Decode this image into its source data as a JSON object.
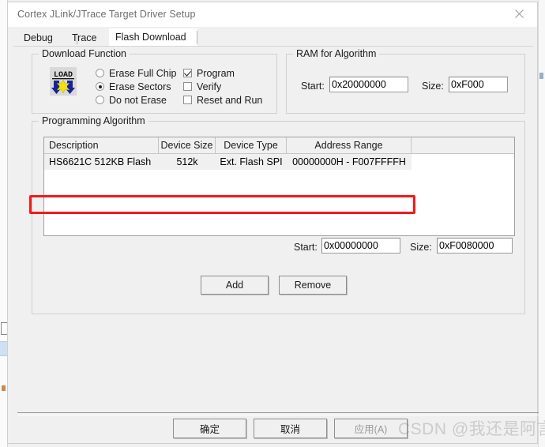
{
  "window": {
    "title": "Cortex JLink/JTrace Target Driver Setup",
    "close_icon": "close-icon"
  },
  "tabs": [
    {
      "label": "Debug",
      "active": false
    },
    {
      "label": "Trace",
      "active": false
    },
    {
      "label": "Flash Download",
      "active": true
    }
  ],
  "download_function": {
    "title": "Download Function",
    "icon": "load-icon",
    "radios": [
      {
        "label": "Erase Full Chip",
        "selected": false
      },
      {
        "label": "Erase Sectors",
        "selected": true
      },
      {
        "label": "Do not Erase",
        "selected": false
      }
    ],
    "checkboxes": [
      {
        "label": "Program",
        "checked": true
      },
      {
        "label": "Verify",
        "checked": false
      },
      {
        "label": "Reset and Run",
        "checked": false
      }
    ]
  },
  "ram_for_algorithm": {
    "title": "RAM for Algorithm",
    "start_label": "Start:",
    "start_value": "0x20000000",
    "size_label": "Size:",
    "size_value": "0xF000"
  },
  "programming_algorithm": {
    "title": "Programming Algorithm",
    "columns": [
      "Description",
      "Device Size",
      "Device Type",
      "Address Range",
      ""
    ],
    "rows": [
      {
        "description": "HS6621C 512KB Flash",
        "device_size": "512k",
        "device_type": "Ext. Flash SPI",
        "address_range": "00000000H - F007FFFFH",
        "extra": "",
        "selected": true,
        "highlighted": true
      }
    ],
    "start_label": "Start:",
    "start_value": "0x00000000",
    "size_label": "Size:",
    "size_value": "0xF0080000",
    "add_button": "Add",
    "remove_button": "Remove"
  },
  "footer": {
    "ok_button": "确定",
    "cancel_button": "取消",
    "apply_button": "应用(A)"
  },
  "watermark": "CSDN @我还是阿言",
  "colors": {
    "annotation": "#f01b1b",
    "dialog_background": "#f0f0f0",
    "field_background": "#ffffff"
  }
}
